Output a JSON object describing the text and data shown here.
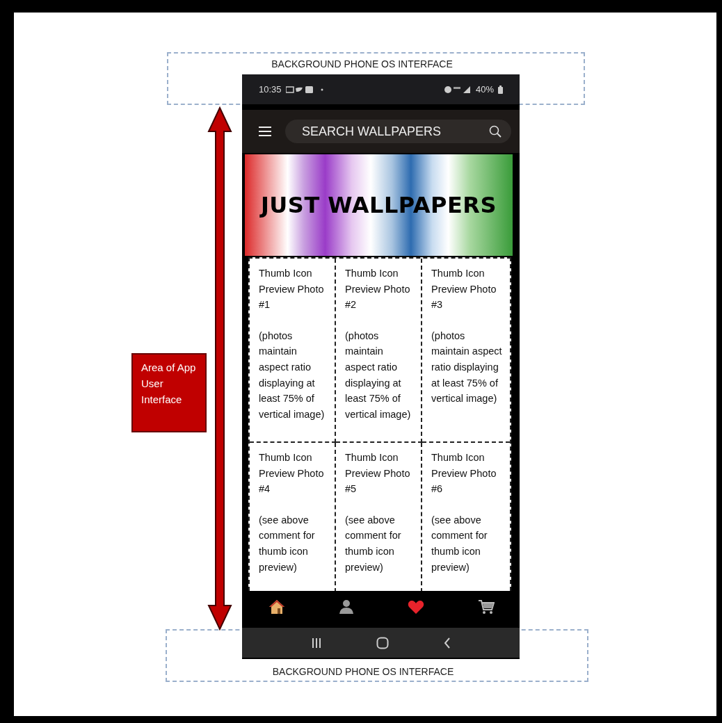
{
  "annotations": {
    "top_label": "BACKGROUND PHONE OS INTERFACE",
    "side_label": "Area of App User Interface",
    "bottom_label": "BACKGROUND PHONE OS INTERFACE"
  },
  "status_bar": {
    "time": "10:35",
    "battery": "40%"
  },
  "search": {
    "placeholder": "SEARCH WALLPAPERS"
  },
  "banner": {
    "title": "JUST WALLPAPERS"
  },
  "thumbnails": [
    {
      "title": "Thumb Icon Preview Photo #1",
      "note": "(photos maintain aspect ratio displaying at least 75% of vertical image)"
    },
    {
      "title": "Thumb Icon Preview Photo #2",
      "note": "(photos maintain aspect ratio displaying at least 75% of vertical image)"
    },
    {
      "title": "Thumb Icon Preview Photo #3",
      "note": "(photos maintain aspect ratio displaying at least 75% of vertical image)"
    },
    {
      "title": "Thumb Icon Preview Photo #4",
      "note": "(see above comment for thumb icon preview)"
    },
    {
      "title": "Thumb Icon Preview Photo #5",
      "note": "(see above comment for thumb icon preview)"
    },
    {
      "title": "Thumb Icon Preview Photo #6",
      "note": "(see above comment for thumb icon preview)"
    }
  ],
  "bottom_nav": [
    {
      "kind": "home"
    },
    {
      "kind": "profile"
    },
    {
      "kind": "favorites"
    },
    {
      "kind": "cart"
    }
  ],
  "system_nav": [
    {
      "kind": "recents"
    },
    {
      "kind": "home"
    },
    {
      "kind": "back"
    }
  ]
}
